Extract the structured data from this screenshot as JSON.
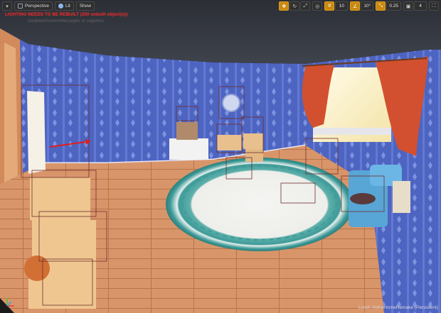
{
  "toolbar_left": {
    "menu_icon": "dropdown-triangle",
    "perspective_label": "Perspective",
    "lit_label": "Lit",
    "show_label": "Show"
  },
  "toolbar_right": {
    "grid_snap_value": "10",
    "rotation_snap_value": "10°",
    "scale_snap_value": "0.25",
    "camera_speed_value": "4"
  },
  "warnings": {
    "lighting": "LIGHTING NEEDS TO BE REBUILT (250 unbuilt object(s))",
    "secondary": "'DisableAllScreenMessages' to suppress"
  },
  "status": {
    "level_text": "Level:  AlohaHomeRemake (Persistent)"
  },
  "colors": {
    "accent": "#c9890f",
    "warning": "#ff2a2a",
    "wall_blue": "#4f67c4",
    "floor_wood": "#d79462",
    "rug_teal": "#3e9b98",
    "curtain_red": "#d2502f"
  }
}
